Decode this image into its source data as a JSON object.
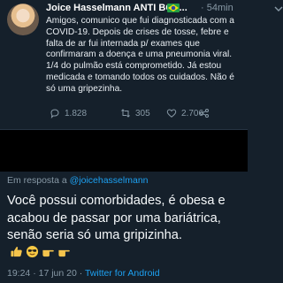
{
  "tweet": {
    "author": "Joice Hasselmann ANTI BOL...",
    "time": "54min",
    "text": "Amigos, comunico que fui diagnosticada com a COVID-19. Depois de crises de tosse, febre e falta de ar fui internada p/ exames que confirmaram a doença e uma pneumonia viral. 1/4 do pulmão está comprometido. Já estou medicada e tomando todos os cuidados. Não é só uma gripezinha.",
    "replies": "1.828",
    "retweets": "305",
    "likes": "2.706"
  },
  "reply": {
    "label": "Em resposta a",
    "handle": "@joicehasselmann",
    "text": "Você possui comorbidades, é obesa e acabou de passar por uma bariátrica, senão seria só uma gripizinha.",
    "emojis": [
      "thumbs-up",
      "sunglasses-face",
      "pointing-right",
      "pointing-right"
    ],
    "timestamp": "19:24 · 17 jun 20 ·",
    "source": "Twitter for Android"
  },
  "colors": {
    "background": "#15202b",
    "secondary_text": "#8899a6",
    "link": "#1da1f2",
    "redaction": "#000000"
  }
}
